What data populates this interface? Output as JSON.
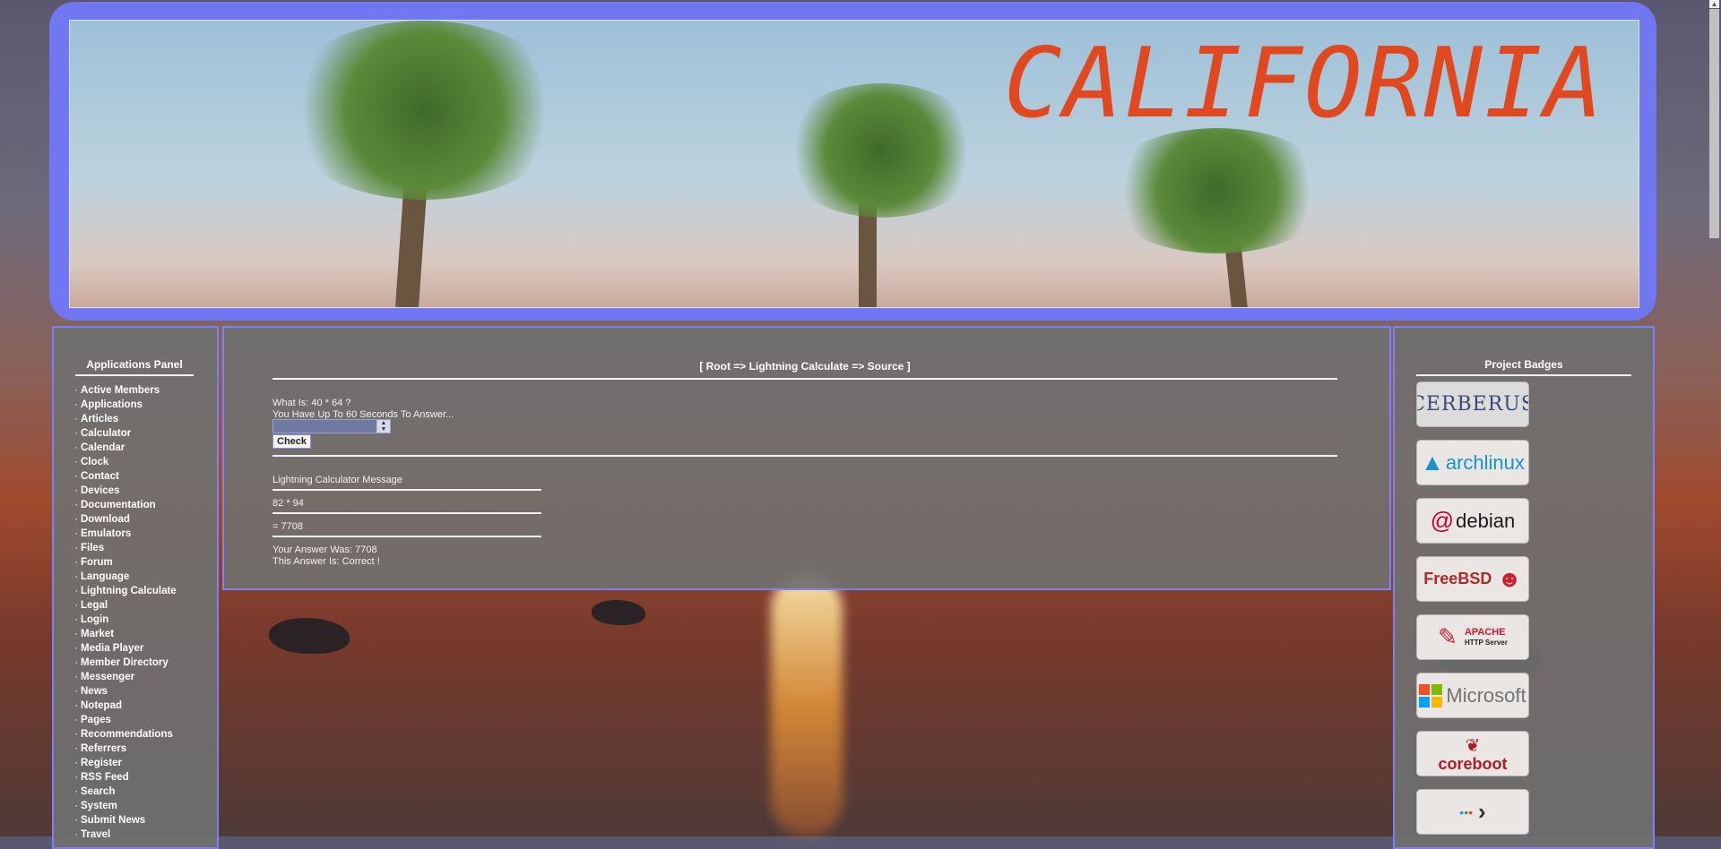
{
  "banner": {
    "title": "CALIFORNIA"
  },
  "left_panel": {
    "title": "Applications Panel",
    "items": [
      "Active Members",
      "Applications",
      "Articles",
      "Calculator",
      "Calendar",
      "Clock",
      "Contact",
      "Devices",
      "Documentation",
      "Download",
      "Emulators",
      "Files",
      "Forum",
      "Language",
      "Lightning Calculate",
      "Legal",
      "Login",
      "Market",
      "Media Player",
      "Member Directory",
      "Messenger",
      "News",
      "Notepad",
      "Pages",
      "Recommendations",
      "Referrers",
      "Register",
      "RSS Feed",
      "Search",
      "System",
      "Submit News",
      "Travel"
    ]
  },
  "center_panel": {
    "breadcrumb": "[ Root => Lightning Calculate => Source ]",
    "question": "What Is: 40 * 64 ?",
    "time_limit": "You Have Up To 60 Seconds To Answer...",
    "answer_value": "",
    "check_label": "Check",
    "message_title": "Lightning Calculator Message",
    "expression": "82 * 94",
    "result": "= 7708",
    "your_answer": "Your Answer Was: 7708",
    "verdict": "This Answer Is: Correct !"
  },
  "right_panel": {
    "title": "Project Badges",
    "badges": [
      {
        "name": "cerberus-badge",
        "label": "CERBERUS",
        "color": "#3a4a7a"
      },
      {
        "name": "archlinux-badge",
        "label": "archlinux",
        "color": "#1793d1"
      },
      {
        "name": "debian-badge",
        "label": "debian",
        "color": "#1b1b1b"
      },
      {
        "name": "freebsd-badge",
        "label": "FreeBSD",
        "color": "#ab2b28"
      },
      {
        "name": "apache-badge",
        "label": "APACHE",
        "sub": "HTTP Server",
        "color": "#c8202f"
      },
      {
        "name": "microsoft-badge",
        "label": "Microsoft",
        "color": "#737373"
      },
      {
        "name": "coreboot-badge",
        "label": "coreboot",
        "color": "#b11a22"
      },
      {
        "name": "prompt-badge",
        "label": "",
        "color": "#333333"
      }
    ]
  }
}
